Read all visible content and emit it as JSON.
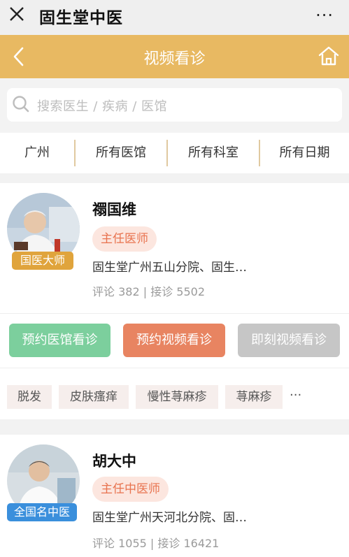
{
  "app": {
    "title": "固生堂中医",
    "more": "···"
  },
  "header": {
    "title": "视频看诊"
  },
  "search": {
    "placeholder": "搜索医生 / 疾病 / 医馆"
  },
  "filters": [
    "广州",
    "所有医馆",
    "所有科室",
    "所有日期"
  ],
  "doctors": [
    {
      "name": "禤国维",
      "badge": "国医大师",
      "title": "主任医师",
      "hospital": "固生堂广州五山分院、固生…",
      "stats": "评论 382 | 接诊 5502",
      "actions": [
        "预约医馆看诊",
        "预约视频看诊",
        "即刻视频看诊"
      ],
      "tags": [
        "脱发",
        "皮肤瘙痒",
        "慢性荨麻疹",
        "荨麻疹"
      ],
      "tags_more": "···"
    },
    {
      "name": "胡大中",
      "badge": "全国名中医",
      "title": "主任中医师",
      "hospital": "固生堂广州天河北分院、固…",
      "stats": "评论 1055 | 接诊 16421"
    }
  ],
  "colors": {
    "header": "#e8b962",
    "btn_clinic": "#7ccf9d",
    "btn_video": "#e88461",
    "btn_now": "#c6c6c6",
    "title_tag_bg": "#fce6df",
    "title_tag_text": "#e8734f"
  },
  "icons": [
    "close-icon",
    "more-icon",
    "back-icon",
    "home-icon",
    "search-icon"
  ]
}
